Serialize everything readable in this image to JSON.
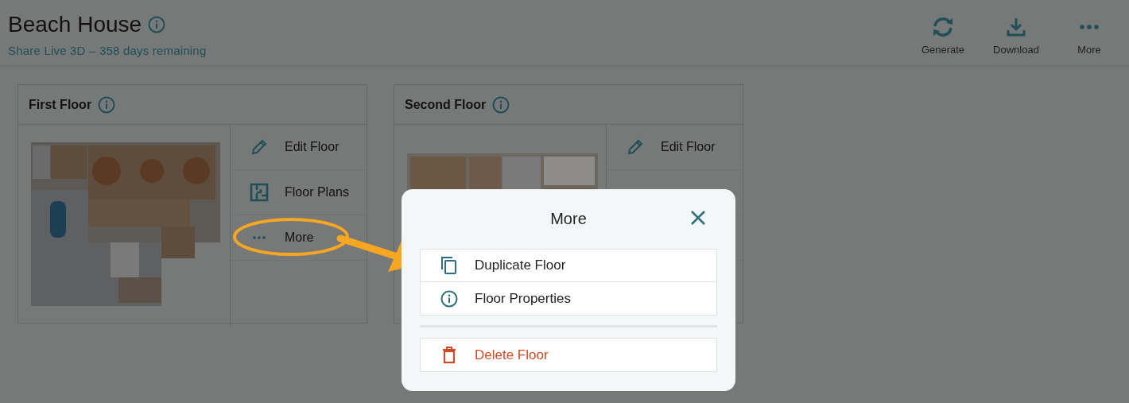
{
  "header": {
    "title": "Beach House",
    "subtitle": "Share Live 3D – 358 days remaining"
  },
  "toolbar": [
    {
      "kind": "generate",
      "label": "Generate"
    },
    {
      "kind": "download",
      "label": "Download"
    },
    {
      "kind": "more",
      "label": "More"
    }
  ],
  "floors": [
    {
      "name": "First Floor",
      "actions": [
        {
          "kind": "edit",
          "label": "Edit Floor"
        },
        {
          "kind": "plans",
          "label": "Floor Plans"
        },
        {
          "kind": "more",
          "label": "More"
        }
      ]
    },
    {
      "name": "Second Floor",
      "actions": [
        {
          "kind": "edit",
          "label": "Edit Floor"
        }
      ]
    }
  ],
  "dialog": {
    "title": "More",
    "items": [
      {
        "kind": "duplicate",
        "label": "Duplicate Floor"
      },
      {
        "kind": "properties",
        "label": "Floor Properties"
      },
      {
        "kind": "delete",
        "label": "Delete Floor"
      }
    ]
  }
}
